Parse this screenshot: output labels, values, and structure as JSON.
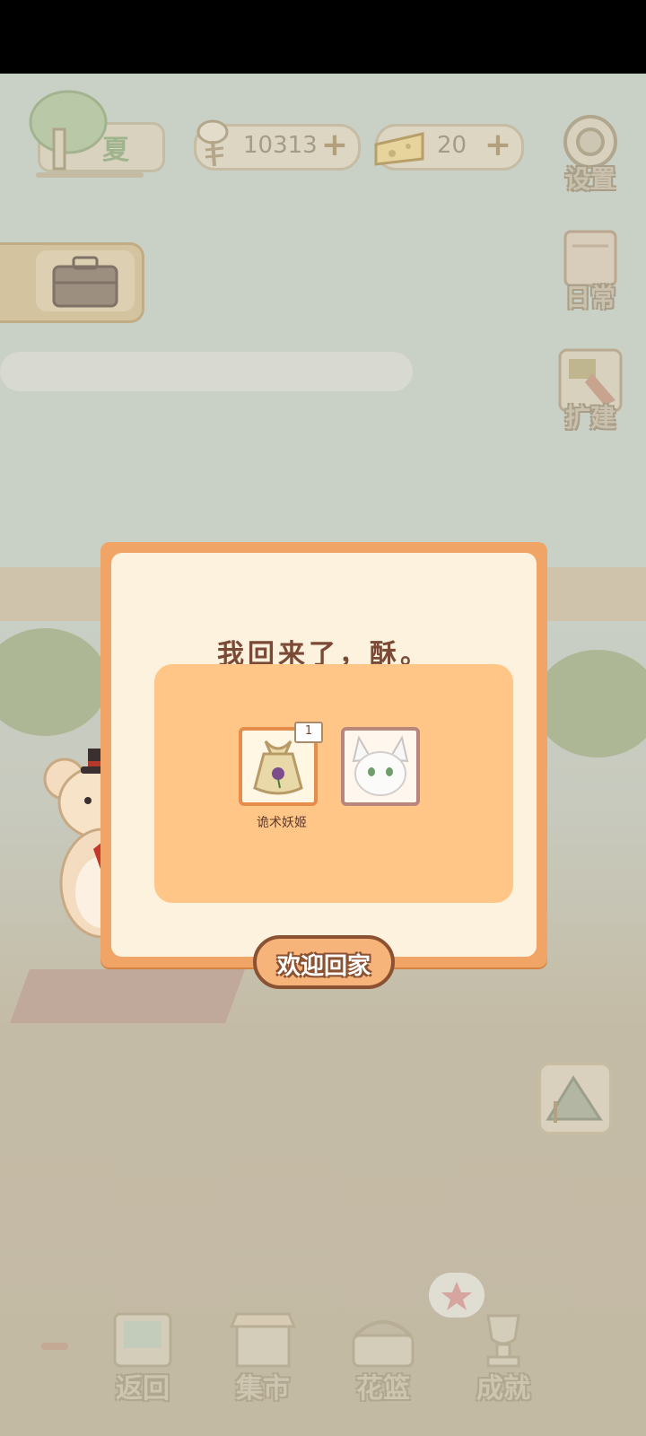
{
  "hud": {
    "season_label": "夏",
    "fish_count": "10313",
    "cheese_count": "20",
    "plus_symbol": "+"
  },
  "side_menu": {
    "settings_label": "设置",
    "daily_label": "日常",
    "expand_label": "扩建"
  },
  "modal": {
    "title": "我回来了，酥。",
    "items": [
      {
        "label": "诡术妖姬",
        "count": "1",
        "icon": "flower-seed-bag-icon"
      },
      {
        "label": "",
        "count": "",
        "icon": "white-fox-portrait-icon"
      }
    ],
    "confirm_label": "欢迎回家"
  },
  "bottom_nav": [
    {
      "label": "返回",
      "icon": "window-door-icon"
    },
    {
      "label": "集市",
      "icon": "market-stall-icon"
    },
    {
      "label": "花篮",
      "icon": "flower-basket-icon"
    },
    {
      "label": "成就",
      "icon": "trophy-icon"
    }
  ],
  "colors": {
    "modal_border": "#f0a466",
    "modal_bg": "#fdf2dd",
    "panel_bg": "#ffc687",
    "title_text": "#7a4a36",
    "button_border": "#8a5232"
  }
}
